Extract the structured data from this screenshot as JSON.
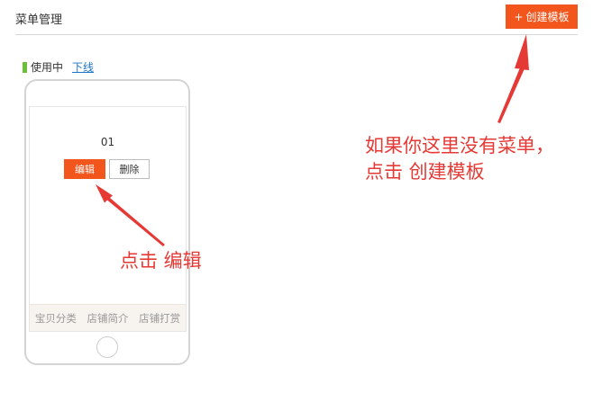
{
  "header": {
    "title": "菜单管理",
    "create_button": {
      "icon_text": "+",
      "label": "创建模板"
    }
  },
  "status": {
    "label": "使用中",
    "offline_link": "下线"
  },
  "template_preview": {
    "name": "01",
    "edit_label": "编辑",
    "delete_label": "删除",
    "bottom_nav": [
      "宝贝分类",
      "店铺简介",
      "店铺打赏"
    ]
  },
  "annotations": {
    "create_hint": "如果你这里没有菜单，\n点击 创建模板",
    "edit_hint": "点击 编辑"
  },
  "colors": {
    "accent": "#f2561d",
    "status_green": "#6cbf3a",
    "link": "#1f76c9",
    "annotation": "#e53935"
  }
}
